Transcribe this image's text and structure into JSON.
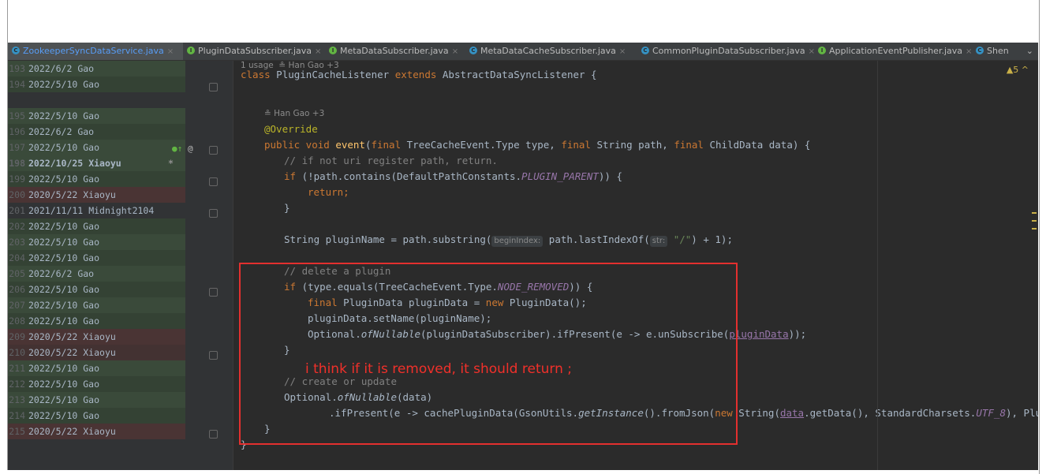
{
  "tabs": [
    {
      "label": "ZookeeperSyncDataService.java",
      "kind": "class",
      "active": true
    },
    {
      "label": "PluginDataSubscriber.java",
      "kind": "interface",
      "active": false
    },
    {
      "label": "MetaDataSubscriber.java",
      "kind": "interface",
      "active": false
    },
    {
      "label": "MetaDataCacheSubscriber.java",
      "kind": "class",
      "active": false
    },
    {
      "label": "CommonPluginDataSubscriber.java",
      "kind": "class",
      "active": false
    },
    {
      "label": "ApplicationEventPublisher.java",
      "kind": "interface",
      "active": false
    },
    {
      "label": "Shen",
      "kind": "class",
      "active": false
    }
  ],
  "tab_more": "⌄",
  "warnings": {
    "label": "▲5 ^"
  },
  "blame": [
    {
      "line": "193",
      "date": "2022/6/2",
      "author": "Gao",
      "tone": "g"
    },
    {
      "line": "194",
      "date": "2022/5/10",
      "author": "Gao",
      "tone": "g2"
    },
    {
      "line": "",
      "date": "",
      "author": "",
      "tone": "n"
    },
    {
      "line": "195",
      "date": "2022/5/10",
      "author": "Gao",
      "tone": "g"
    },
    {
      "line": "196",
      "date": "2022/6/2",
      "author": "Gao",
      "tone": "g2"
    },
    {
      "line": "197",
      "date": "2022/5/10",
      "author": "Gao",
      "tone": "g"
    },
    {
      "line": "198",
      "date": "2022/10/25",
      "author": "Xiaoyu",
      "tone": "g",
      "star": "*"
    },
    {
      "line": "199",
      "date": "2022/5/10",
      "author": "Gao",
      "tone": "g2"
    },
    {
      "line": "200",
      "date": "2020/5/22",
      "author": "Xiaoyu",
      "tone": "r"
    },
    {
      "line": "201",
      "date": "2021/11/11",
      "author": "Midnight2104",
      "tone": "n"
    },
    {
      "line": "202",
      "date": "2022/5/10",
      "author": "Gao",
      "tone": "g2"
    },
    {
      "line": "203",
      "date": "2022/5/10",
      "author": "Gao",
      "tone": "g"
    },
    {
      "line": "204",
      "date": "2022/5/10",
      "author": "Gao",
      "tone": "g2"
    },
    {
      "line": "205",
      "date": "2022/6/2",
      "author": "Gao",
      "tone": "g"
    },
    {
      "line": "206",
      "date": "2022/5/10",
      "author": "Gao",
      "tone": "g2"
    },
    {
      "line": "207",
      "date": "2022/5/10",
      "author": "Gao",
      "tone": "g"
    },
    {
      "line": "208",
      "date": "2022/5/10",
      "author": "Gao",
      "tone": "g2"
    },
    {
      "line": "209",
      "date": "2020/5/22",
      "author": "Xiaoyu",
      "tone": "r"
    },
    {
      "line": "210",
      "date": "2020/5/22",
      "author": "Xiaoyu",
      "tone": "r2"
    },
    {
      "line": "211",
      "date": "2022/5/10",
      "author": "Gao",
      "tone": "g"
    },
    {
      "line": "212",
      "date": "2022/5/10",
      "author": "Gao",
      "tone": "g2"
    },
    {
      "line": "213",
      "date": "2022/5/10",
      "author": "Gao",
      "tone": "g"
    },
    {
      "line": "214",
      "date": "2022/5/10",
      "author": "Gao",
      "tone": "g2"
    },
    {
      "line": "215",
      "date": "2020/5/22",
      "author": "Xiaoyu",
      "tone": "r"
    }
  ],
  "code": {
    "usage_hint": "1 usage  ≗ Han Gao +3",
    "class_decl": {
      "kw": "class",
      "name": " PluginCacheListener ",
      "kw2": "extends",
      "rest": " AbstractDataSyncListener {"
    },
    "author_hint": "≗ Han Gao +3",
    "override": "@Override",
    "event_sig": {
      "kw1": "public void ",
      "fn": "event",
      "p1": "(",
      "kw2": "final",
      "p2": " TreeCacheEvent.Type type, ",
      "kw3": "final",
      "p3": " String path, ",
      "kw4": "final",
      "p4": " ChildData data) {"
    },
    "comment_uri": "// if not uri register path, return.",
    "if_path": {
      "kw": "if",
      "a": " (!path.contains(DefaultPathConstants.",
      "c": "PLUGIN_PARENT",
      "b": ")) {"
    },
    "ret": "return;",
    "close1": "}",
    "plugin_name": {
      "a": "String pluginName = path.substring(",
      "h1": "beginIndex:",
      "b": " path.lastIndexOf(",
      "h2": "str:",
      "s": "\"/\"",
      "c": ") + 1);"
    },
    "comment_delete": "// delete a plugin",
    "if_removed": {
      "kw": "if",
      "a": " (type.equals(TreeCacheEvent.Type.",
      "c": "NODE_REMOVED",
      "b": ")) {"
    },
    "final_pd": {
      "kw": "final",
      "a": " PluginData pluginData = ",
      "kw2": "new",
      "b": " PluginData();"
    },
    "set_name": "pluginData.setName(pluginName);",
    "optional1": {
      "a": "Optional.",
      "m": "ofNullable",
      "b": "(pluginDataSubscriber).ifPresent(e -> e.unSubscribe(",
      "u": "pluginData",
      "c": "));"
    },
    "close2": "}",
    "comment_create": "// create or update",
    "optional2": {
      "a": "Optional.",
      "m": "ofNullable",
      "b": "(data)"
    },
    "if_present": {
      "a": ".ifPresent(e -> cachePluginData(GsonUtils.",
      "m": "getInstance",
      "b": "().fromJson(",
      "kw": "new",
      "c": " String(",
      "u": "data",
      "d": ".getData(), StandardCharsets.",
      "cn": "UTF_8",
      "e": "), PluginData.clas"
    },
    "close3": "}",
    "close4": "}"
  },
  "annotation": {
    "text": "i think if it is removed, it should return ;"
  },
  "colors": {
    "annotation": "#e3302f",
    "background": "#2b2b2b"
  }
}
